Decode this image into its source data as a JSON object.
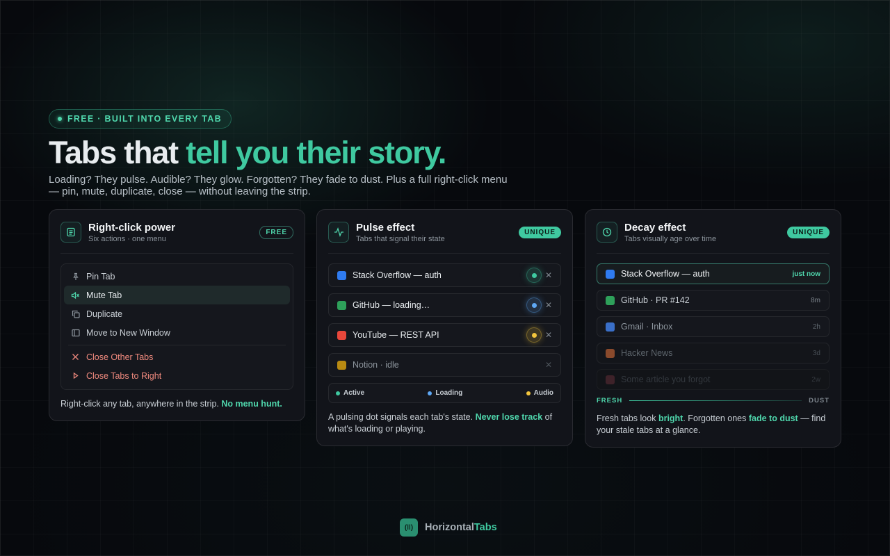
{
  "pill": {
    "text": "FREE · BUILT INTO EVERY TAB"
  },
  "headline": {
    "part1": "Tabs that ",
    "part2": "tell you their story."
  },
  "subline": "Loading? They pulse. Audible? They glow. Forgotten? They fade to dust. Plus a full right-click menu — pin, mute, duplicate, close — without leaving the strip.",
  "cards": {
    "menu": {
      "title": "Right-click power",
      "subtitle": "Six actions · one menu",
      "badge": "FREE",
      "items": [
        {
          "label": "Pin Tab",
          "icon": "pin-icon"
        },
        {
          "label": "Mute Tab",
          "icon": "mute-icon"
        },
        {
          "label": "Duplicate",
          "icon": "duplicate-icon"
        },
        {
          "label": "Move to New Window",
          "icon": "window-icon"
        },
        {
          "label": "Close Other Tabs",
          "icon": "close-icon"
        },
        {
          "label": "Close Tabs to Right",
          "icon": "arrow-right-icon"
        }
      ],
      "foot_text": "Right-click any tab, anywhere in the strip. ",
      "foot_bold": "No menu hunt."
    },
    "pulse": {
      "title": "Pulse effect",
      "subtitle": "Tabs that signal their state",
      "badge": "UNIQUE",
      "tabs": [
        {
          "label": "Stack Overflow — auth",
          "favicon_color": "#2f7bf0",
          "state_color": "#3fc9a0"
        },
        {
          "label": "GitHub — loading…",
          "favicon_color": "#2ea05a",
          "state_color": "#5ea8f5"
        },
        {
          "label": "YouTube — REST API",
          "favicon_color": "#e8473b",
          "state_color": "#f2c53d"
        },
        {
          "label": "Notion · idle",
          "favicon_color": "#b88a12",
          "state_color": ""
        }
      ],
      "legend": [
        {
          "label": "Active",
          "color": "#3fc9a0"
        },
        {
          "label": "Loading",
          "color": "#5ea8f5"
        },
        {
          "label": "Audio",
          "color": "#f2c53d"
        }
      ],
      "foot_text1": "A pulsing dot signals each tab's state. ",
      "foot_bold": "Never lose track",
      "foot_text2": " of what's loading or playing."
    },
    "decay": {
      "title": "Decay effect",
      "subtitle": "Tabs visually age over time",
      "badge": "UNIQUE",
      "tabs": [
        {
          "label": "Stack Overflow — auth",
          "age": "just now",
          "favicon_color": "#2f7bf0"
        },
        {
          "label": "GitHub · PR #142",
          "age": "8m",
          "favicon_color": "#2ea05a"
        },
        {
          "label": "Gmail · Inbox",
          "age": "2h",
          "favicon_color": "#3a6fc8"
        },
        {
          "label": "Hacker News",
          "age": "3d",
          "favicon_color": "#a8562e"
        },
        {
          "label": "Some article you forgot",
          "age": "2w",
          "favicon_color": "#5a2a35"
        }
      ],
      "scale_start": "FRESH",
      "scale_end": "DUST",
      "foot_text1": "Fresh tabs look ",
      "foot_bold1": "bright",
      "foot_text2": ". Forgotten ones ",
      "foot_bold2": "fade to dust",
      "foot_text3": " — find your stale tabs at a glance."
    }
  },
  "brand": {
    "part1": "Horizontal",
    "part2": "Tabs"
  }
}
